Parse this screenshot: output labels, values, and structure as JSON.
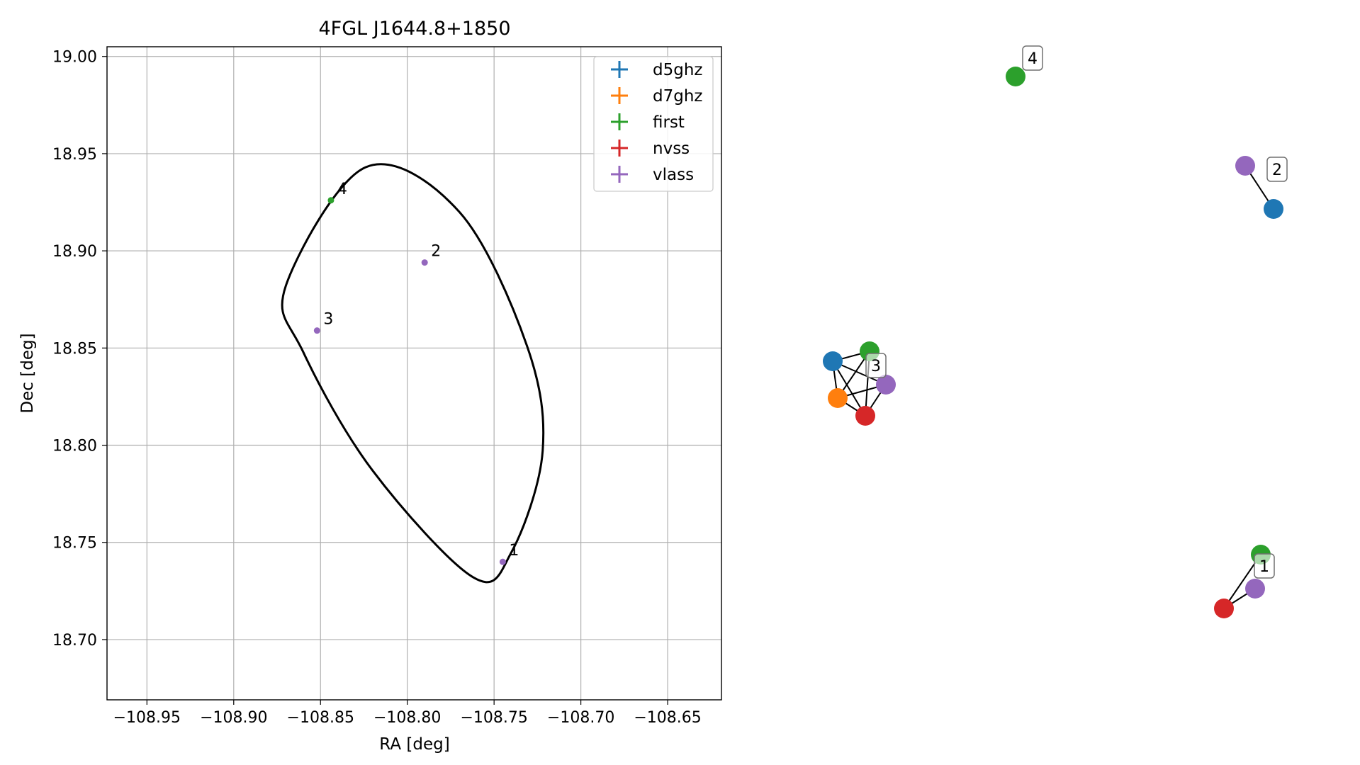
{
  "chart_data": [
    {
      "type": "scatter",
      "title": "4FGL J1644.8+1850",
      "xlabel": "RA [deg]",
      "ylabel": "Dec [deg]",
      "xlim": [
        -108.973,
        -108.619
      ],
      "ylim": [
        18.669,
        19.005
      ],
      "xticks": [
        -108.95,
        -108.9,
        -108.85,
        -108.8,
        -108.75,
        -108.7,
        -108.65
      ],
      "yticks": [
        18.7,
        18.75,
        18.8,
        18.85,
        18.9,
        18.95,
        19.0
      ],
      "xtick_labels": [
        "−108.95",
        "−108.90",
        "−108.85",
        "−108.80",
        "−108.75",
        "−108.70",
        "−108.65"
      ],
      "ytick_labels": [
        "18.70",
        "18.75",
        "18.80",
        "18.85",
        "18.90",
        "18.95",
        "19.00"
      ],
      "grid": true,
      "legend_position": "top-right",
      "legend": [
        {
          "name": "d5ghz",
          "color": "#1f77b4"
        },
        {
          "name": "d7ghz",
          "color": "#ff7f0e"
        },
        {
          "name": "first",
          "color": "#2ca02c"
        },
        {
          "name": "nvss",
          "color": "#d62728"
        },
        {
          "name": "vlass",
          "color": "#9467bd"
        }
      ],
      "points": [
        {
          "label": "1",
          "x": -108.745,
          "y": 18.74,
          "color": "#9467bd"
        },
        {
          "label": "2",
          "x": -108.79,
          "y": 18.894,
          "color": "#9467bd"
        },
        {
          "label": "3",
          "x": -108.852,
          "y": 18.859,
          "color": "#9467bd"
        },
        {
          "label": "4",
          "x": -108.844,
          "y": 18.926,
          "color": "#2ca02c"
        }
      ],
      "ellipse": {
        "center": [
          -108.796,
          18.838
        ],
        "outline_points": [
          [
            -108.824,
            18.943
          ],
          [
            -108.87,
            18.882
          ],
          [
            -108.86,
            18.848
          ],
          [
            -108.82,
            18.787
          ],
          [
            -108.762,
            18.732
          ],
          [
            -108.74,
            18.745
          ],
          [
            -108.722,
            18.797
          ],
          [
            -108.731,
            18.851
          ],
          [
            -108.77,
            18.92
          ]
        ],
        "color": "#000000"
      }
    },
    {
      "type": "network",
      "nodes": [
        {
          "id": "g4-first",
          "color": "#2ca02c"
        },
        {
          "id": "g2-vlass",
          "color": "#9467bd"
        },
        {
          "id": "g2-d5ghz",
          "color": "#1f77b4"
        },
        {
          "id": "g3-d5ghz",
          "color": "#1f77b4"
        },
        {
          "id": "g3-first",
          "color": "#2ca02c"
        },
        {
          "id": "g3-vlass",
          "color": "#9467bd"
        },
        {
          "id": "g3-d7ghz",
          "color": "#ff7f0e"
        },
        {
          "id": "g3-nvss",
          "color": "#d62728"
        },
        {
          "id": "g1-first",
          "color": "#2ca02c"
        },
        {
          "id": "g1-vlass",
          "color": "#9467bd"
        },
        {
          "id": "g1-nvss",
          "color": "#d62728"
        }
      ],
      "edges": [
        [
          "g2-vlass",
          "g2-d5ghz"
        ],
        [
          "g3-d5ghz",
          "g3-first"
        ],
        [
          "g3-d5ghz",
          "g3-vlass"
        ],
        [
          "g3-d5ghz",
          "g3-d7ghz"
        ],
        [
          "g3-d5ghz",
          "g3-nvss"
        ],
        [
          "g3-first",
          "g3-d7ghz"
        ],
        [
          "g3-first",
          "g3-nvss"
        ],
        [
          "g3-vlass",
          "g3-d7ghz"
        ],
        [
          "g3-vlass",
          "g3-nvss"
        ],
        [
          "g3-d7ghz",
          "g3-nvss"
        ],
        [
          "g1-first",
          "g1-nvss"
        ],
        [
          "g1-vlass",
          "g1-nvss"
        ]
      ],
      "group_labels": [
        {
          "text": "4",
          "anchor": "g4-first"
        },
        {
          "text": "2",
          "anchor": "g2-vlass"
        },
        {
          "text": "3",
          "anchor": "g3-first"
        },
        {
          "text": "1",
          "anchor": "g1-first"
        }
      ]
    }
  ]
}
